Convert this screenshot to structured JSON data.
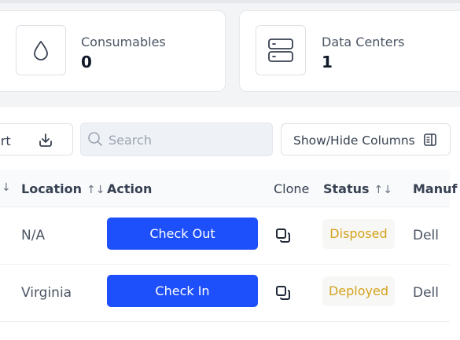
{
  "cards": [
    {
      "label": "Consumables",
      "value": "0",
      "icon": "droplet-icon"
    },
    {
      "label": "Data Centers",
      "value": "1",
      "icon": "server-icon"
    }
  ],
  "toolbar": {
    "export_label": "ort",
    "search_placeholder": "Search",
    "columns_label": "Show/Hide Columns"
  },
  "table": {
    "headers": {
      "first_sort": "↓",
      "location": "Location",
      "action": "Action",
      "clone": "Clone",
      "status": "Status",
      "manufacturer": "Manuf",
      "sort_glyph": "↑↓"
    },
    "rows": [
      {
        "location": "N/A",
        "action": "Check Out",
        "status": "Disposed",
        "manufacturer": "Dell"
      },
      {
        "location": "Virginia",
        "action": "Check In",
        "status": "Deployed",
        "manufacturer": "Dell"
      }
    ]
  },
  "colors": {
    "primary": "#1d4ffa",
    "status_text": "#d4a21c",
    "background": "#f3f4f6"
  }
}
